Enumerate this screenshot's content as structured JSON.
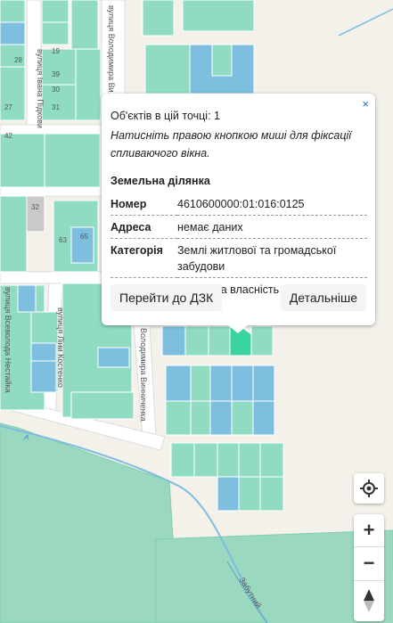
{
  "popup": {
    "close_label": "×",
    "count_text": "Об'єктів в цій точці: 1",
    "hint_text": "Натисніть правою кнопкою миші для фіксації спливаючого вікна.",
    "section_title": "Земельна ділянка",
    "rows": [
      {
        "key": "Номер",
        "value": "4610600000:01:016:0125"
      },
      {
        "key": "Адреса",
        "value": "немає даних"
      },
      {
        "key": "Категорія",
        "value": "Землі житлової та громадської забудови"
      },
      {
        "key": "Власність",
        "value": "Приватна власність"
      }
    ],
    "button_dzk": "Перейти до ДЗК",
    "button_more": "Детальніше"
  },
  "map": {
    "street_labels": [
      "вулиця Володимира Ви...",
      "вулиця Івана Підкови",
      "вулиця Всеволода Нестайка",
      "вулиця Ліни Костенко",
      "Володимира Винниченка",
      "Забутний"
    ],
    "parcel_numbers": [
      "28",
      "19",
      "31",
      "30",
      "27",
      "42",
      "32",
      "63",
      "65",
      "39"
    ],
    "colors": {
      "background": "#f3f1ea",
      "parcel_green": "#8fdcc2",
      "parcel_blue": "#7ebfe0",
      "parcel_selected": "#3cd3a3",
      "park_green": "#9ad9bf",
      "road": "#ffffff",
      "river": "#7fbde0"
    }
  },
  "controls": {
    "locate_icon": "locate-crosshair-icon",
    "zoom_in": "+",
    "zoom_out": "−",
    "compass_icon": "compass-icon"
  }
}
